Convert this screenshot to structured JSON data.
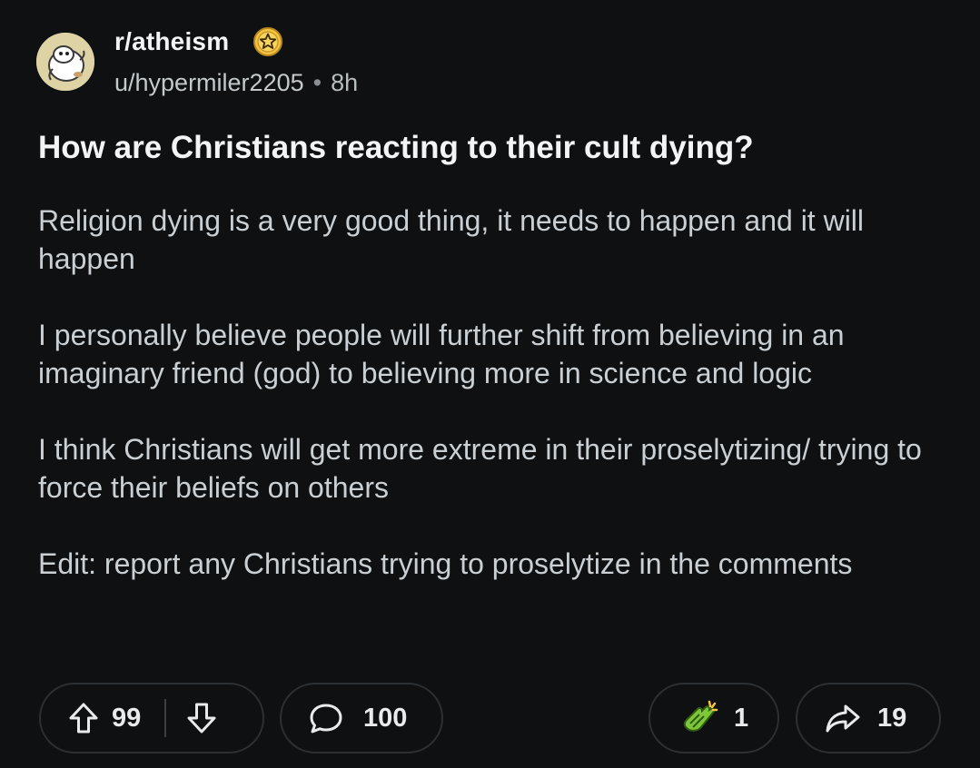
{
  "header": {
    "subreddit": "r/atheism",
    "username": "u/hypermiler2205",
    "separator": "•",
    "age": "8h",
    "icons": {
      "avatar": "snoo-avatar",
      "badge": "star-badge-icon"
    }
  },
  "post": {
    "title": "How are Christians reacting to their cult dying?",
    "paragraphs": [
      "Religion dying is a very good thing, it needs to happen and it will happen",
      "I personally believe people will further shift from believing in an imaginary friend (god) to believing more in science and logic",
      "I think Christians will get more extreme in their proselytizing/ trying to force their beliefs on others",
      "Edit: report any Christians trying to proselytize in the comments"
    ]
  },
  "actions": {
    "score": "99",
    "comments": "100",
    "awards": "1",
    "shares": "19",
    "icons": {
      "upvote": "upvote-arrow-icon",
      "downvote": "downvote-arrow-icon",
      "comment": "comment-bubble-icon",
      "award": "clapping-hands-award-icon",
      "share": "share-arrow-icon"
    }
  },
  "colors": {
    "background": "#0e1012",
    "title": "#f2f4f5",
    "body_text": "#c9cfd3",
    "meta_text": "#b7bcbf",
    "pill_border": "#2c3033",
    "badge_gold": "#f5c542",
    "award_green": "#7ec63a"
  }
}
